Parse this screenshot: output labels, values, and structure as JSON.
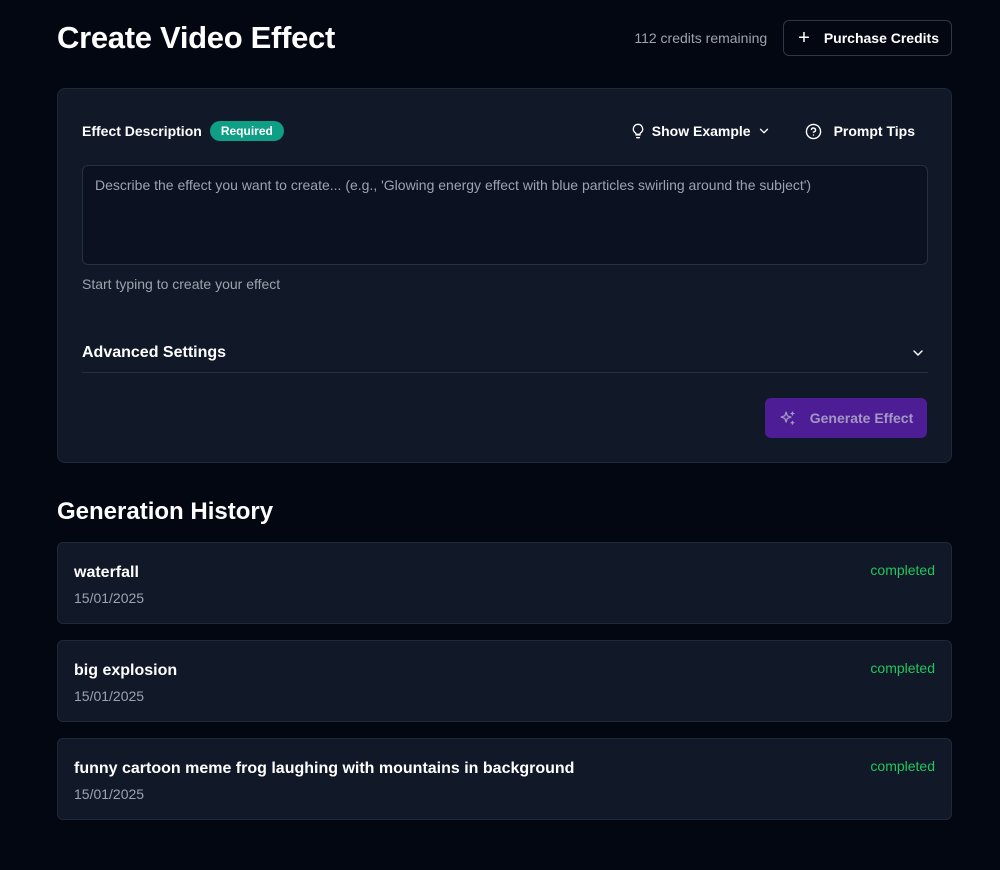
{
  "header": {
    "title": "Create Video Effect",
    "credits_text": "112 credits remaining",
    "purchase_label": "Purchase Credits",
    "purchase_icon": "plus-icon"
  },
  "effect_form": {
    "label": "Effect Description",
    "required_badge": "Required",
    "show_example_label": "Show Example",
    "show_example_icon": "lightbulb-icon",
    "prompt_tips_label": "Prompt Tips",
    "prompt_tips_icon": "help-circle-icon",
    "input_value": "",
    "input_placeholder": "Describe the effect you want to create... (e.g., 'Glowing energy effect with blue particles swirling around the subject')",
    "hint": "Start typing to create your effect",
    "advanced_label": "Advanced Settings",
    "generate_label": "Generate Effect",
    "generate_icon": "sparkles-icon"
  },
  "history": {
    "title": "Generation History",
    "items": [
      {
        "title": "waterfall",
        "date": "15/01/2025",
        "status": "completed"
      },
      {
        "title": "big explosion",
        "date": "15/01/2025",
        "status": "completed"
      },
      {
        "title": "funny cartoon meme frog laughing with mountains in background",
        "date": "15/01/2025",
        "status": "completed"
      }
    ]
  },
  "colors": {
    "background": "#030712",
    "card": "#111827",
    "badge": "#0f9e86",
    "primary_button": "#4c1d95",
    "status_completed": "#22c55e"
  }
}
